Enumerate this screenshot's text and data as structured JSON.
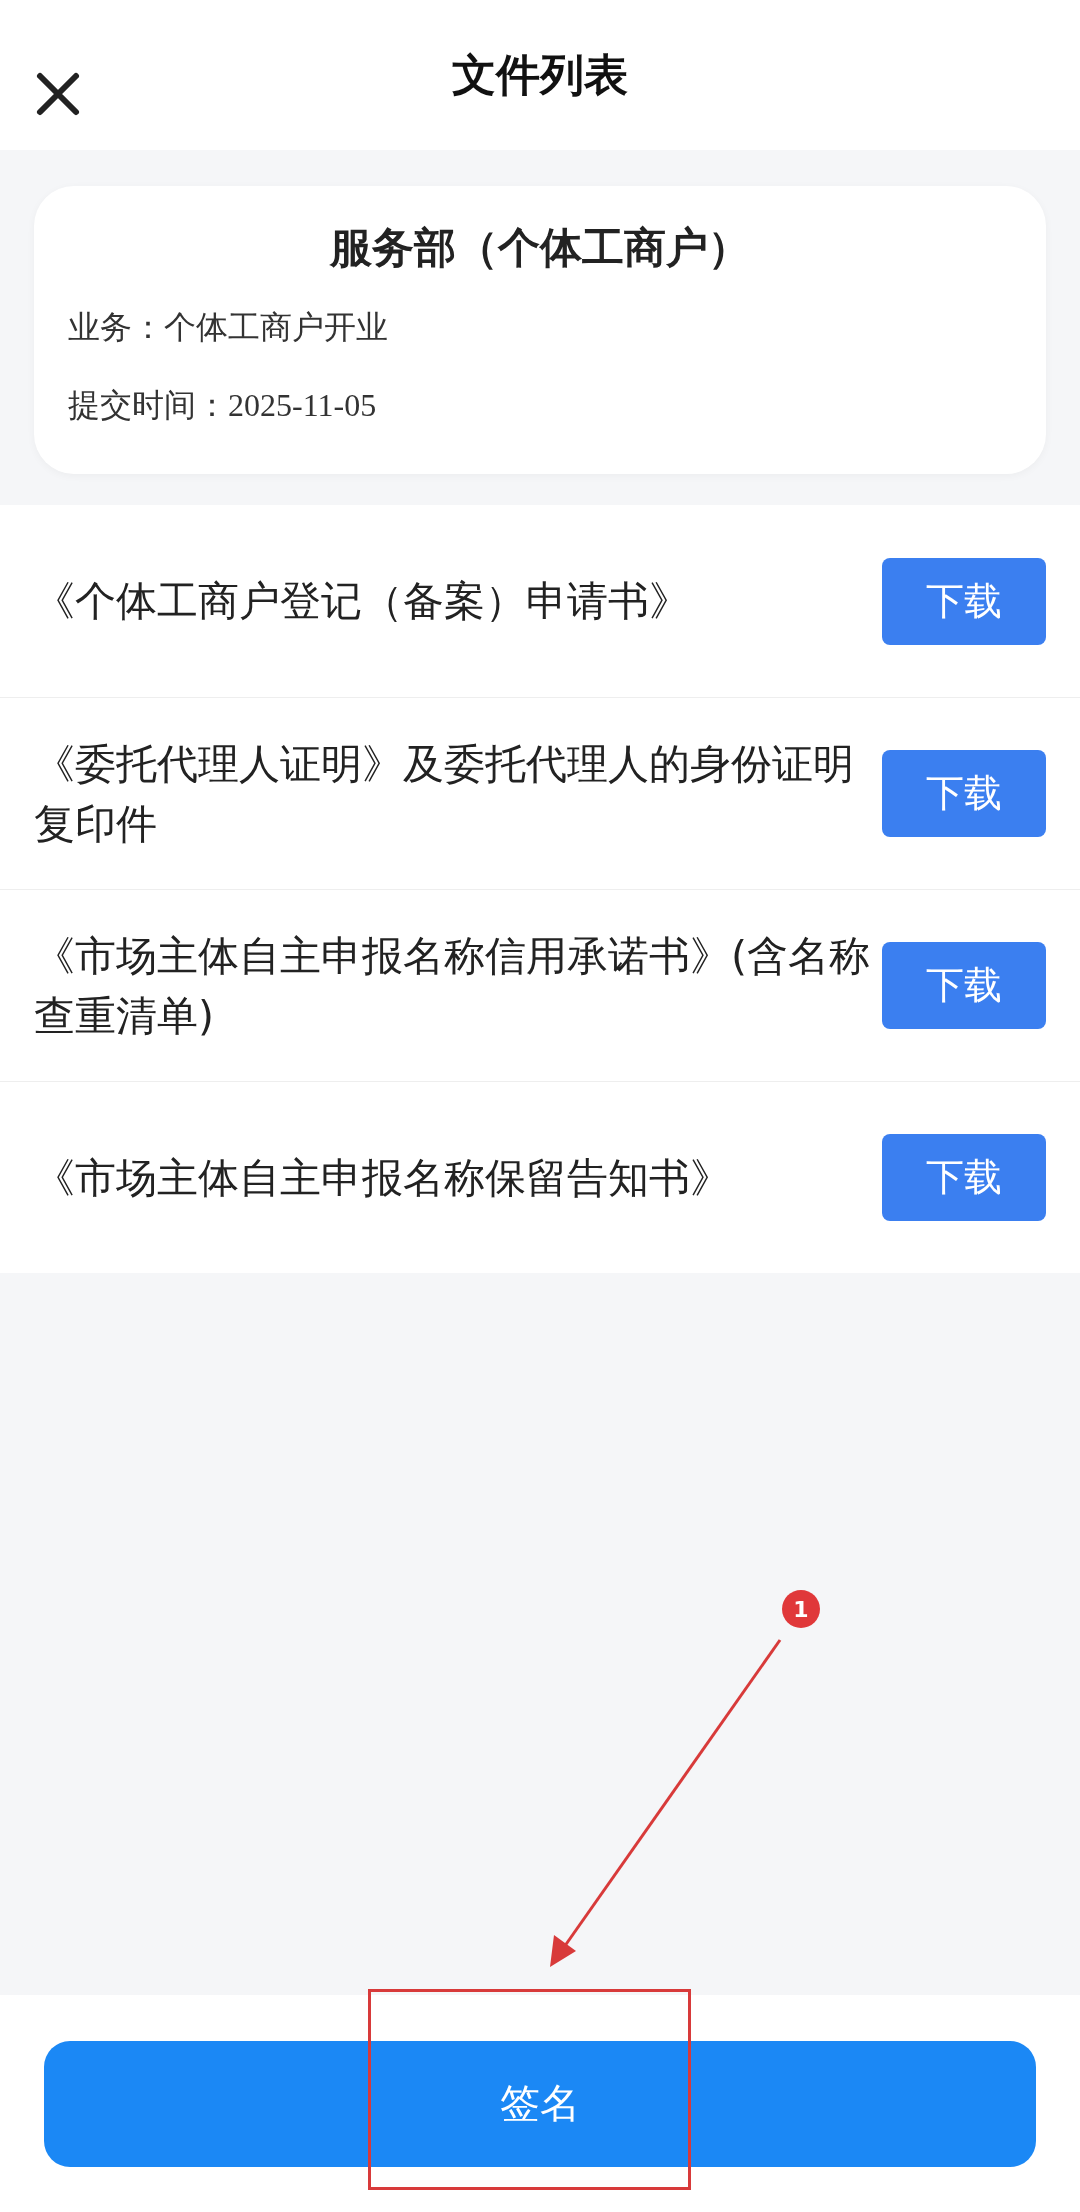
{
  "header": {
    "title": "文件列表"
  },
  "summary": {
    "title": "服务部（个体工商户）",
    "lines": [
      "业务：个体工商户开业",
      "提交时间：2025-11-05"
    ]
  },
  "files": [
    {
      "name": "《个体工商户登记（备案）申请书》",
      "action": "下载"
    },
    {
      "name": "《委托代理人证明》及委托代理人的身份证明复印件",
      "action": "下载"
    },
    {
      "name": "《市场主体自主申报名称信用承诺书》(含名称查重清单)",
      "action": "下载"
    },
    {
      "name": "《市场主体自主申报名称保留告知书》",
      "action": "下载"
    }
  ],
  "sign_button": {
    "label": "签名"
  },
  "annotation": {
    "badge": "1"
  }
}
